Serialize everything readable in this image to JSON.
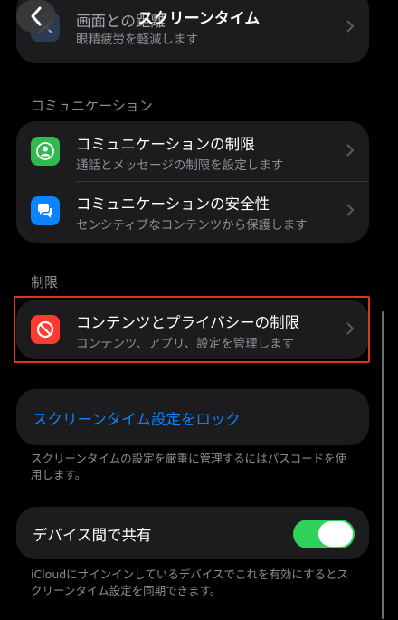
{
  "nav": {
    "title": "スクリーンタイム"
  },
  "top_card": {
    "title": "画面との距離",
    "subtitle": "眼精疲労を軽減します"
  },
  "communication": {
    "header": "コミュニケーション",
    "items": [
      {
        "title": "コミュニケーションの制限",
        "subtitle": "通話とメッセージの制限を設定します",
        "icon": "person-circle-icon",
        "color": "#30b94e"
      },
      {
        "title": "コミュニケーションの安全性",
        "subtitle": "センシティブなコンテンツから保護します",
        "icon": "chat-bubble-icon",
        "color": "#0a84ff"
      }
    ]
  },
  "restrictions": {
    "header": "制限",
    "items": [
      {
        "title": "コンテンツとプライバシーの制限",
        "subtitle": "コンテンツ、アプリ、設定を管理します",
        "icon": "no-entry-icon",
        "color": "#ff3b30"
      }
    ]
  },
  "lock": {
    "label": "スクリーンタイム設定をロック",
    "footer": "スクリーンタイムの設定を厳重に管理するにはパスコードを使用します。"
  },
  "share": {
    "label": "デバイス間で共有",
    "enabled": true,
    "footer": "iCloudにサインインしているデバイスでこれを有効にするとスクリーンタイム設定を同期できます。"
  },
  "colors": {
    "accent": "#0a84ff",
    "toggle_on": "#30d158",
    "highlight": "#e0341c"
  }
}
